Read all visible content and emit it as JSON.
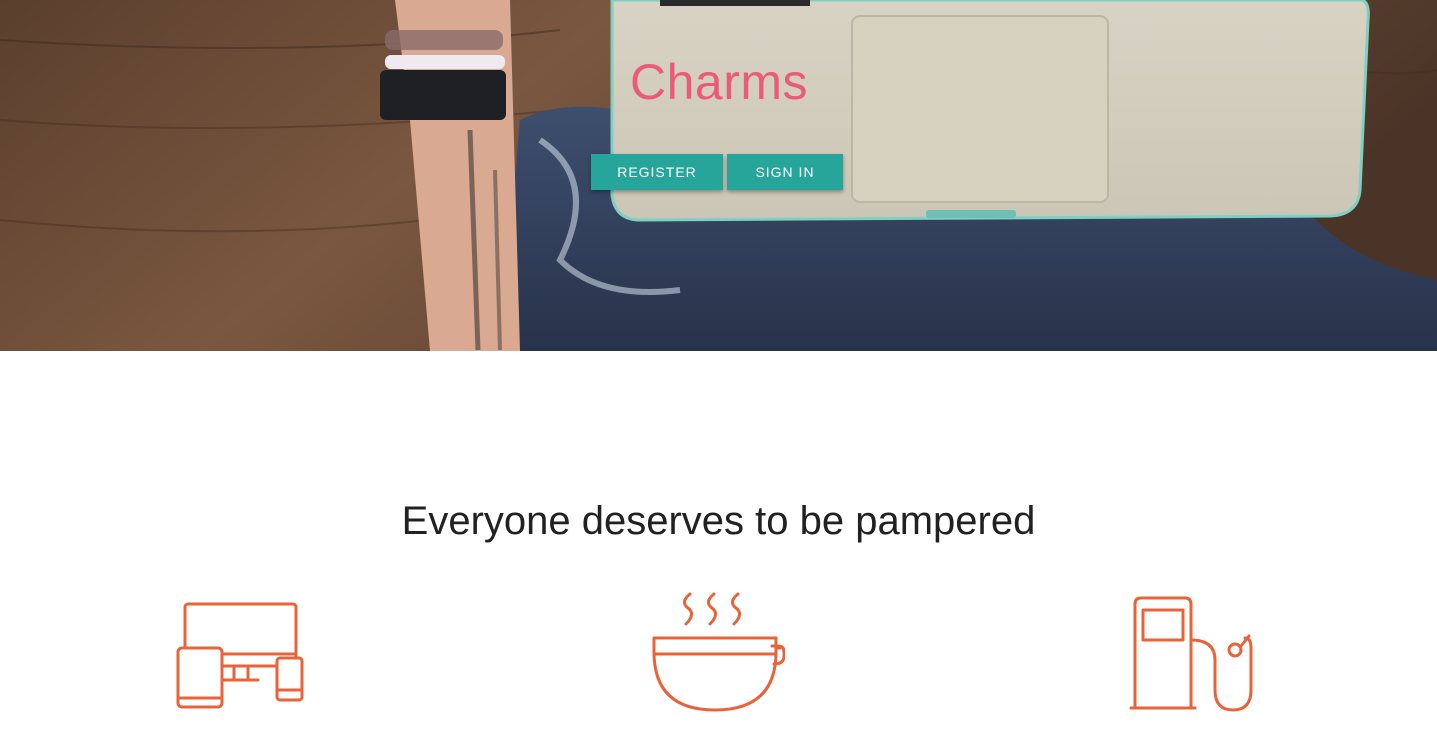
{
  "hero": {
    "title": "Charms",
    "register_label": "REGISTER",
    "signin_label": "SIGN IN"
  },
  "section": {
    "heading": "Everyone deserves to be pampered"
  },
  "features": [
    {
      "icon": "devices-icon"
    },
    {
      "icon": "coffee-cup-icon"
    },
    {
      "icon": "gas-pump-icon"
    }
  ],
  "colors": {
    "accent": "#26a69a",
    "title": "#ec5a7a",
    "icon": "#e8633a"
  }
}
